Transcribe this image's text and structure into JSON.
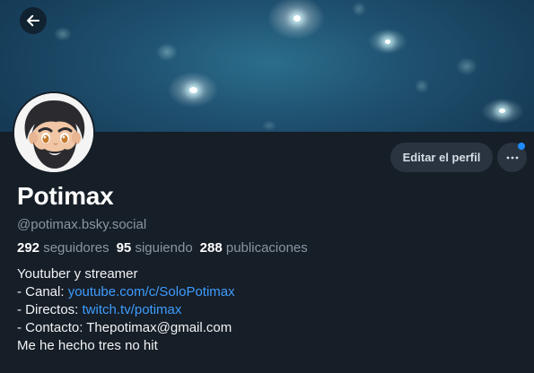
{
  "colors": {
    "background": "#161e27",
    "link": "#3e9cff",
    "muted": "#8a96a3",
    "button_bg": "#2a3441",
    "notification_dot": "#1d8bff"
  },
  "header": {
    "back_icon": "arrow-left-icon"
  },
  "actions": {
    "edit_label": "Editar el perfil",
    "more_icon": "ellipsis-icon"
  },
  "profile": {
    "display_name": "Potimax",
    "handle": "@potimax.bsky.social"
  },
  "stats": {
    "followers_count": "292",
    "followers_label": "seguidores",
    "following_count": "95",
    "following_label": "siguiendo",
    "posts_count": "288",
    "posts_label": "publicaciones"
  },
  "bio": {
    "line1": "Youtuber y streamer",
    "canal_prefix": "- Canal: ",
    "canal_link": "youtube.com/c/SoloPotimax",
    "directos_prefix": "- Directos: ",
    "directos_link": "twitch.tv/potimax",
    "contacto": "- Contacto: Thepotimax@gmail.com",
    "last_line": "Me he hecho tres no hit"
  }
}
